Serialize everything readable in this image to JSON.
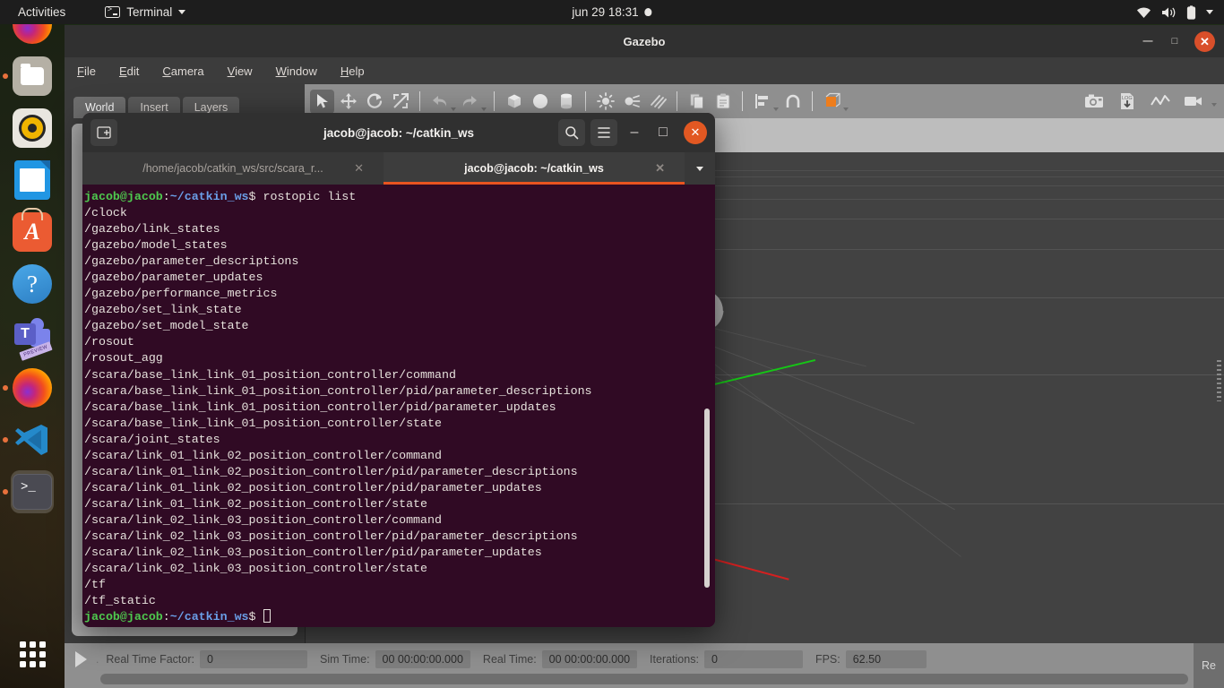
{
  "topbar": {
    "activities": "Activities",
    "app_menu": "Terminal",
    "app_icon": "terminal-icon",
    "clock": "jun 29  18:31",
    "notification_icon": "notification-dot",
    "tray_icons": [
      "wifi-icon",
      "volume-icon",
      "battery-icon",
      "chevron-down-icon"
    ]
  },
  "dock": {
    "items": [
      {
        "name": "firefox-partial",
        "icon": "firefox-icon",
        "running": false
      },
      {
        "name": "files",
        "icon": "files-icon",
        "running": true
      },
      {
        "name": "rhythmbox",
        "icon": "rhythmbox-icon",
        "running": false
      },
      {
        "name": "libreoffice-writer",
        "icon": "writer-icon",
        "running": false
      },
      {
        "name": "ubuntu-software",
        "icon": "software-icon",
        "running": false
      },
      {
        "name": "help",
        "icon": "help-icon",
        "running": false
      },
      {
        "name": "microsoft-teams",
        "icon": "teams-icon",
        "running": false,
        "badge": "PREVIEW"
      },
      {
        "name": "firefox",
        "icon": "firefox-icon",
        "running": true
      },
      {
        "name": "vscode",
        "icon": "vscode-icon",
        "running": true
      },
      {
        "name": "terminal",
        "icon": "terminal-icon",
        "running": true,
        "active": true
      }
    ],
    "show_apps": "show-applications-icon"
  },
  "gazebo": {
    "title": "Gazebo",
    "menu": [
      {
        "label": "File",
        "mnemonic": "F"
      },
      {
        "label": "Edit",
        "mnemonic": "E"
      },
      {
        "label": "Camera",
        "mnemonic": "C"
      },
      {
        "label": "View",
        "mnemonic": "V"
      },
      {
        "label": "Window",
        "mnemonic": "W"
      },
      {
        "label": "Help",
        "mnemonic": "H"
      }
    ],
    "panel_tabs": [
      {
        "label": "World",
        "selected": true
      },
      {
        "label": "Insert",
        "selected": false
      },
      {
        "label": "Layers",
        "selected": false
      }
    ],
    "toolbar_icons": [
      "select-arrow-icon",
      "translate-icon",
      "rotate-icon",
      "scale-icon",
      "undo-icon",
      "redo-icon",
      "box-icon",
      "sphere-icon",
      "cylinder-icon",
      "point-light-icon",
      "spot-light-icon",
      "directional-light-icon",
      "copy-icon",
      "paste-icon",
      "align-icon",
      "snap-icon",
      "view-angle-icon"
    ],
    "toolbar_right_icons": [
      "screenshot-icon",
      "log-save-icon",
      "plot-icon",
      "video-record-icon"
    ],
    "window_buttons": [
      "minimize",
      "maximize",
      "close"
    ],
    "status": {
      "play_icon": "play-icon",
      "real_time_factor_label": "Real Time Factor:",
      "real_time_factor_value": "0",
      "sim_time_label": "Sim Time:",
      "sim_time_value": "00 00:00:00.000",
      "real_time_label": "Real Time:",
      "real_time_value": "00 00:00:00.000",
      "iterations_label": "Iterations:",
      "iterations_value": "0",
      "fps_label": "FPS:",
      "fps_value": "62.50",
      "reset_label": "Re"
    },
    "scene": {
      "model": "scara-robot",
      "axes": [
        "x-axis-red",
        "y-axis-green",
        "z-axis-blue"
      ]
    }
  },
  "terminal": {
    "title": "jacob@jacob: ~/catkin_ws",
    "new_tab_icon": "new-tab-icon",
    "search_icon": "search-icon",
    "menu_icon": "hamburger-menu-icon",
    "minimize_icon": "minimize-icon",
    "maximize_icon": "maximize-icon",
    "close_icon": "close-icon",
    "tab_list_icon": "chevron-down-icon",
    "tabs": [
      {
        "label": "/home/jacob/catkin_ws/src/scara_r...",
        "selected": false
      },
      {
        "label": "jacob@jacob: ~/catkin_ws",
        "selected": true
      }
    ],
    "prompt": {
      "user_host": "jacob@jacob",
      "colon": ":",
      "path": "~/catkin_ws",
      "dollar": "$"
    },
    "command": " rostopic list",
    "output": [
      "/clock",
      "/gazebo/link_states",
      "/gazebo/model_states",
      "/gazebo/parameter_descriptions",
      "/gazebo/parameter_updates",
      "/gazebo/performance_metrics",
      "/gazebo/set_link_state",
      "/gazebo/set_model_state",
      "/rosout",
      "/rosout_agg",
      "/scara/base_link_link_01_position_controller/command",
      "/scara/base_link_link_01_position_controller/pid/parameter_descriptions",
      "/scara/base_link_link_01_position_controller/pid/parameter_updates",
      "/scara/base_link_link_01_position_controller/state",
      "/scara/joint_states",
      "/scara/link_01_link_02_position_controller/command",
      "/scara/link_01_link_02_position_controller/pid/parameter_descriptions",
      "/scara/link_01_link_02_position_controller/pid/parameter_updates",
      "/scara/link_01_link_02_position_controller/state",
      "/scara/link_02_link_03_position_controller/command",
      "/scara/link_02_link_03_position_controller/pid/parameter_descriptions",
      "/scara/link_02_link_03_position_controller/pid/parameter_updates",
      "/scara/link_02_link_03_position_controller/state",
      "/tf",
      "/tf_static"
    ]
  },
  "colors": {
    "terminal_bg": "#300a24",
    "accent_orange": "#e95420",
    "prompt_green": "#4ec94e",
    "prompt_blue": "#6a9fe8",
    "gazebo_toolbar": "#8f8f8f",
    "axis_red": "#d42020",
    "axis_green": "#16c516",
    "axis_blue": "#1f1fe0"
  }
}
